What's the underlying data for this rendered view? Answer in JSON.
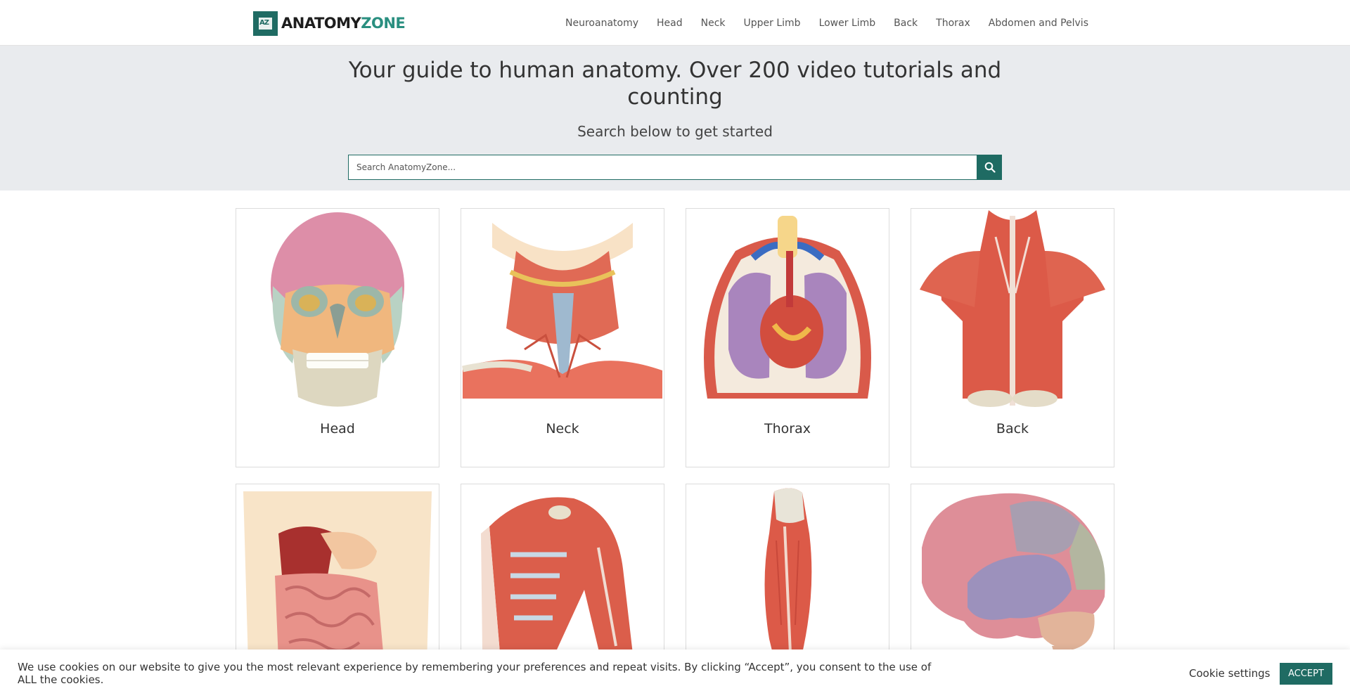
{
  "header": {
    "logo": {
      "part1": "ANATOMY",
      "part2": "ZONE"
    },
    "nav": [
      {
        "label": "Neuroanatomy"
      },
      {
        "label": "Head"
      },
      {
        "label": "Neck"
      },
      {
        "label": "Upper Limb"
      },
      {
        "label": "Lower Limb"
      },
      {
        "label": "Back"
      },
      {
        "label": "Thorax"
      },
      {
        "label": "Abdomen and Pelvis"
      }
    ]
  },
  "hero": {
    "title": "Your guide to human anatomy. Over 200 video tutorials and counting",
    "subtitle": "Search below to get started",
    "search": {
      "placeholder": "Search AnatomyZone...",
      "button_icon": "search-icon"
    }
  },
  "cards": [
    {
      "label": "Head"
    },
    {
      "label": "Neck"
    },
    {
      "label": "Thorax"
    },
    {
      "label": "Back"
    },
    {
      "label": ""
    },
    {
      "label": ""
    },
    {
      "label": ""
    },
    {
      "label": ""
    }
  ],
  "cookie": {
    "text": "We use cookies on our website to give you the most relevant experience by remembering your preferences and repeat visits. By clicking “Accept”, you consent to the use of ALL the cookies.",
    "settings_label": "Cookie settings",
    "accept_label": "ACCEPT"
  },
  "colors": {
    "brand": "#1f6b63",
    "brand_light": "#2a8f80",
    "hero_bg": "#e9ebee"
  }
}
